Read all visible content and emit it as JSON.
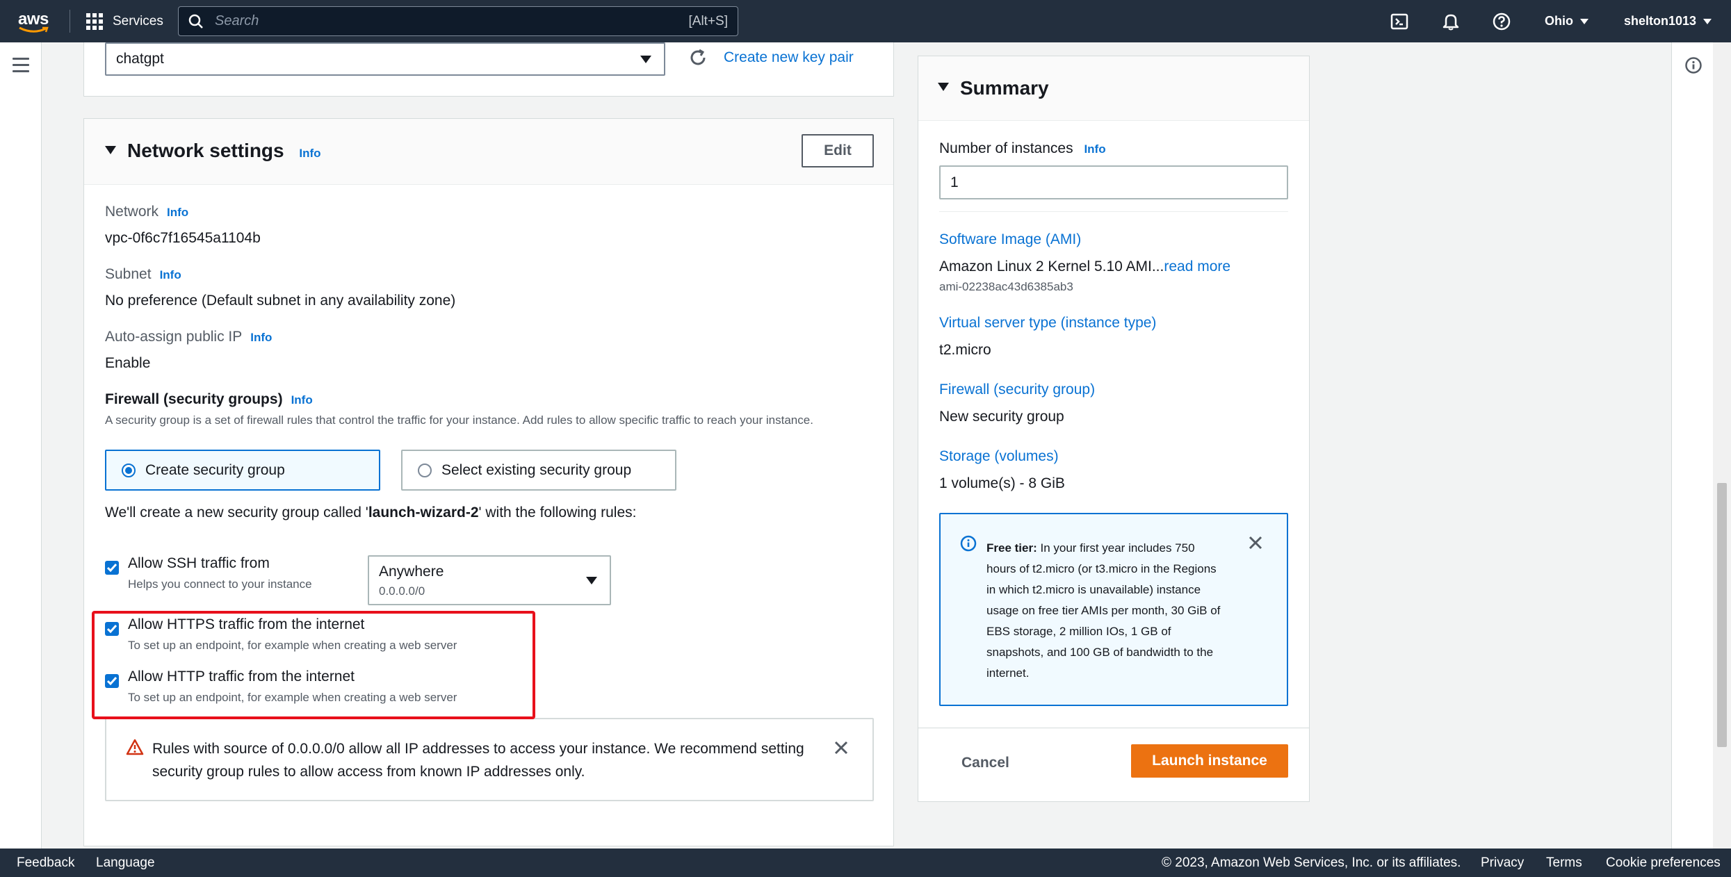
{
  "topnav": {
    "logo_text": "aws",
    "services_label": "Services",
    "search_placeholder": "Search",
    "search_shortcut": "[Alt+S]",
    "region": "Ohio",
    "user": "shelton1013",
    "icons": [
      "cloudshell-icon",
      "bell-icon",
      "help-icon"
    ]
  },
  "key_pair": {
    "selected": "chatgpt",
    "create_link": "Create new key pair"
  },
  "network": {
    "title": "Network settings",
    "info": "Info",
    "edit_label": "Edit",
    "network_label": "Network",
    "network_value": "vpc-0f6c7f16545a1104b",
    "subnet_label": "Subnet",
    "subnet_value": "No preference (Default subnet in any availability zone)",
    "public_ip_label": "Auto-assign public IP",
    "public_ip_value": "Enable",
    "firewall_label": "Firewall (security groups)",
    "firewall_desc": "A security group is a set of firewall rules that control the traffic for your instance. Add rules to allow specific traffic to reach your instance.",
    "option_create": "Create security group",
    "option_existing": "Select existing security group",
    "rules_note_prefix": "We'll create a new security group called '",
    "rules_note_name": "launch-wizard-2",
    "rules_note_suffix": "' with the following rules:",
    "rules": [
      {
        "label": "Allow SSH traffic from",
        "desc": "Helps you connect to your instance",
        "checked": true
      },
      {
        "label": "Allow HTTPS traffic from the internet",
        "desc": "To set up an endpoint, for example when creating a web server",
        "checked": true
      },
      {
        "label": "Allow HTTP traffic from the internet",
        "desc": "To set up an endpoint, for example when creating a web server",
        "checked": true
      }
    ],
    "ssh_source": "Anywhere",
    "ssh_source_cidr": "0.0.0.0/0",
    "warning": "Rules with source of 0.0.0.0/0 allow all IP addresses to access your instance. We recommend setting security group rules to allow access from known IP addresses only."
  },
  "summary": {
    "title": "Summary",
    "instances_label": "Number of instances",
    "info": "Info",
    "instances_value": "1",
    "ami_label": "Software Image (AMI)",
    "ami_value": "Amazon Linux 2 Kernel 5.10 AMI...",
    "ami_read_more": "read more",
    "ami_id": "ami-02238ac43d6385ab3",
    "type_label": "Virtual server type (instance type)",
    "type_value": "t2.micro",
    "firewall_label": "Firewall (security group)",
    "firewall_value": "New security group",
    "storage_label": "Storage (volumes)",
    "storage_value": "1 volume(s) - 8 GiB",
    "free_tier_title": "Free tier:",
    "free_tier_text": " In your first year includes 750 hours of t2.micro (or t3.micro in the Regions in which t2.micro is unavailable) instance usage on free tier AMIs per month, 30 GiB of EBS storage, 2 million IOs, 1 GB of snapshots, and 100 GB of bandwidth to the internet.",
    "cancel_label": "Cancel",
    "launch_label": "Launch instance"
  },
  "footer": {
    "feedback": "Feedback",
    "language": "Language",
    "copyright": "© 2023, Amazon Web Services, Inc. or its affiliates.",
    "privacy": "Privacy",
    "terms": "Terms",
    "cookies": "Cookie preferences"
  },
  "colors": {
    "nav_bg": "#232f3e",
    "link": "#0972d3",
    "primary_button": "#ec7211",
    "highlight": "#e8101b"
  }
}
